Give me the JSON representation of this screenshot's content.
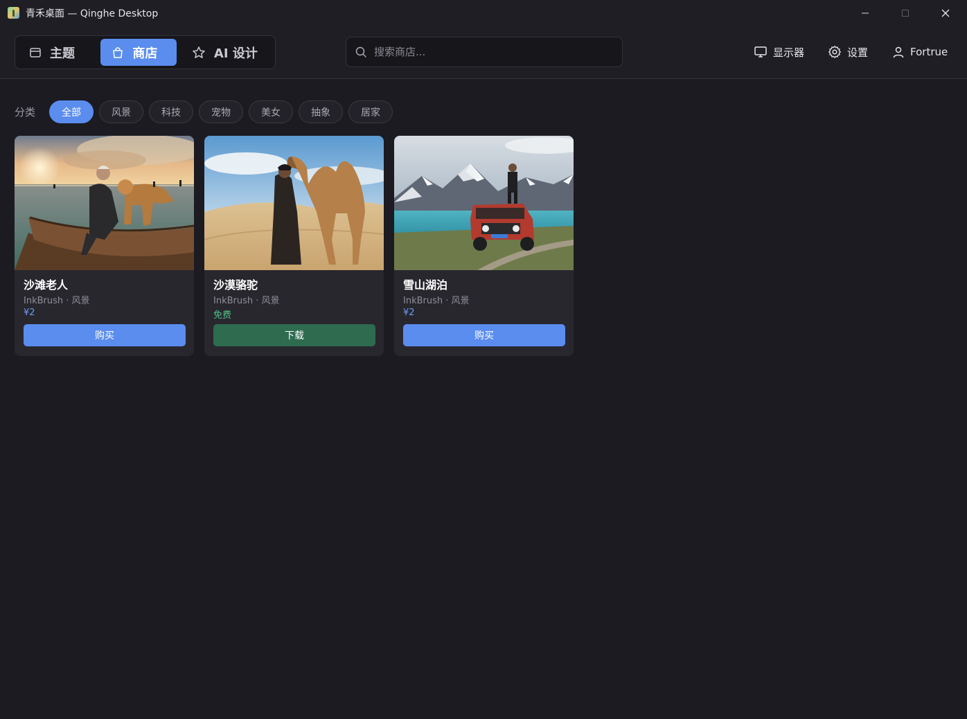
{
  "window": {
    "title": "青禾桌面 — Qinghe Desktop",
    "app_icon": "qinghe-app-icon"
  },
  "nav": {
    "tabs": [
      {
        "label": "主题",
        "icon": "window-icon",
        "active": false
      },
      {
        "label": "商店",
        "icon": "bag-icon",
        "active": true
      },
      {
        "label": "AI 设计",
        "icon": "star-icon",
        "active": false
      }
    ]
  },
  "search": {
    "placeholder": "搜索商店...",
    "value": ""
  },
  "header_actions": {
    "display": "显示器",
    "settings": "设置",
    "user": "Fortrue"
  },
  "categories": {
    "label": "分类",
    "items": [
      {
        "label": "全部",
        "active": true
      },
      {
        "label": "风景",
        "active": false
      },
      {
        "label": "科技",
        "active": false
      },
      {
        "label": "宠物",
        "active": false
      },
      {
        "label": "美女",
        "active": false
      },
      {
        "label": "抽象",
        "active": false
      },
      {
        "label": "居家",
        "active": false
      }
    ]
  },
  "products": [
    {
      "title": "沙滩老人",
      "meta": "InkBrush · 风景",
      "price": "¥2",
      "action": "购买",
      "free": false
    },
    {
      "title": "沙漠骆驼",
      "meta": "InkBrush · 风景",
      "price": "免费",
      "action": "下载",
      "free": true
    },
    {
      "title": "雪山湖泊",
      "meta": "InkBrush · 风景",
      "price": "¥2",
      "action": "购买",
      "free": false
    }
  ],
  "colors": {
    "accent": "#5b8def",
    "background": "#1c1b21",
    "card": "#28272e",
    "free": "#4fc58a",
    "download_button": "#2e6b4f"
  }
}
